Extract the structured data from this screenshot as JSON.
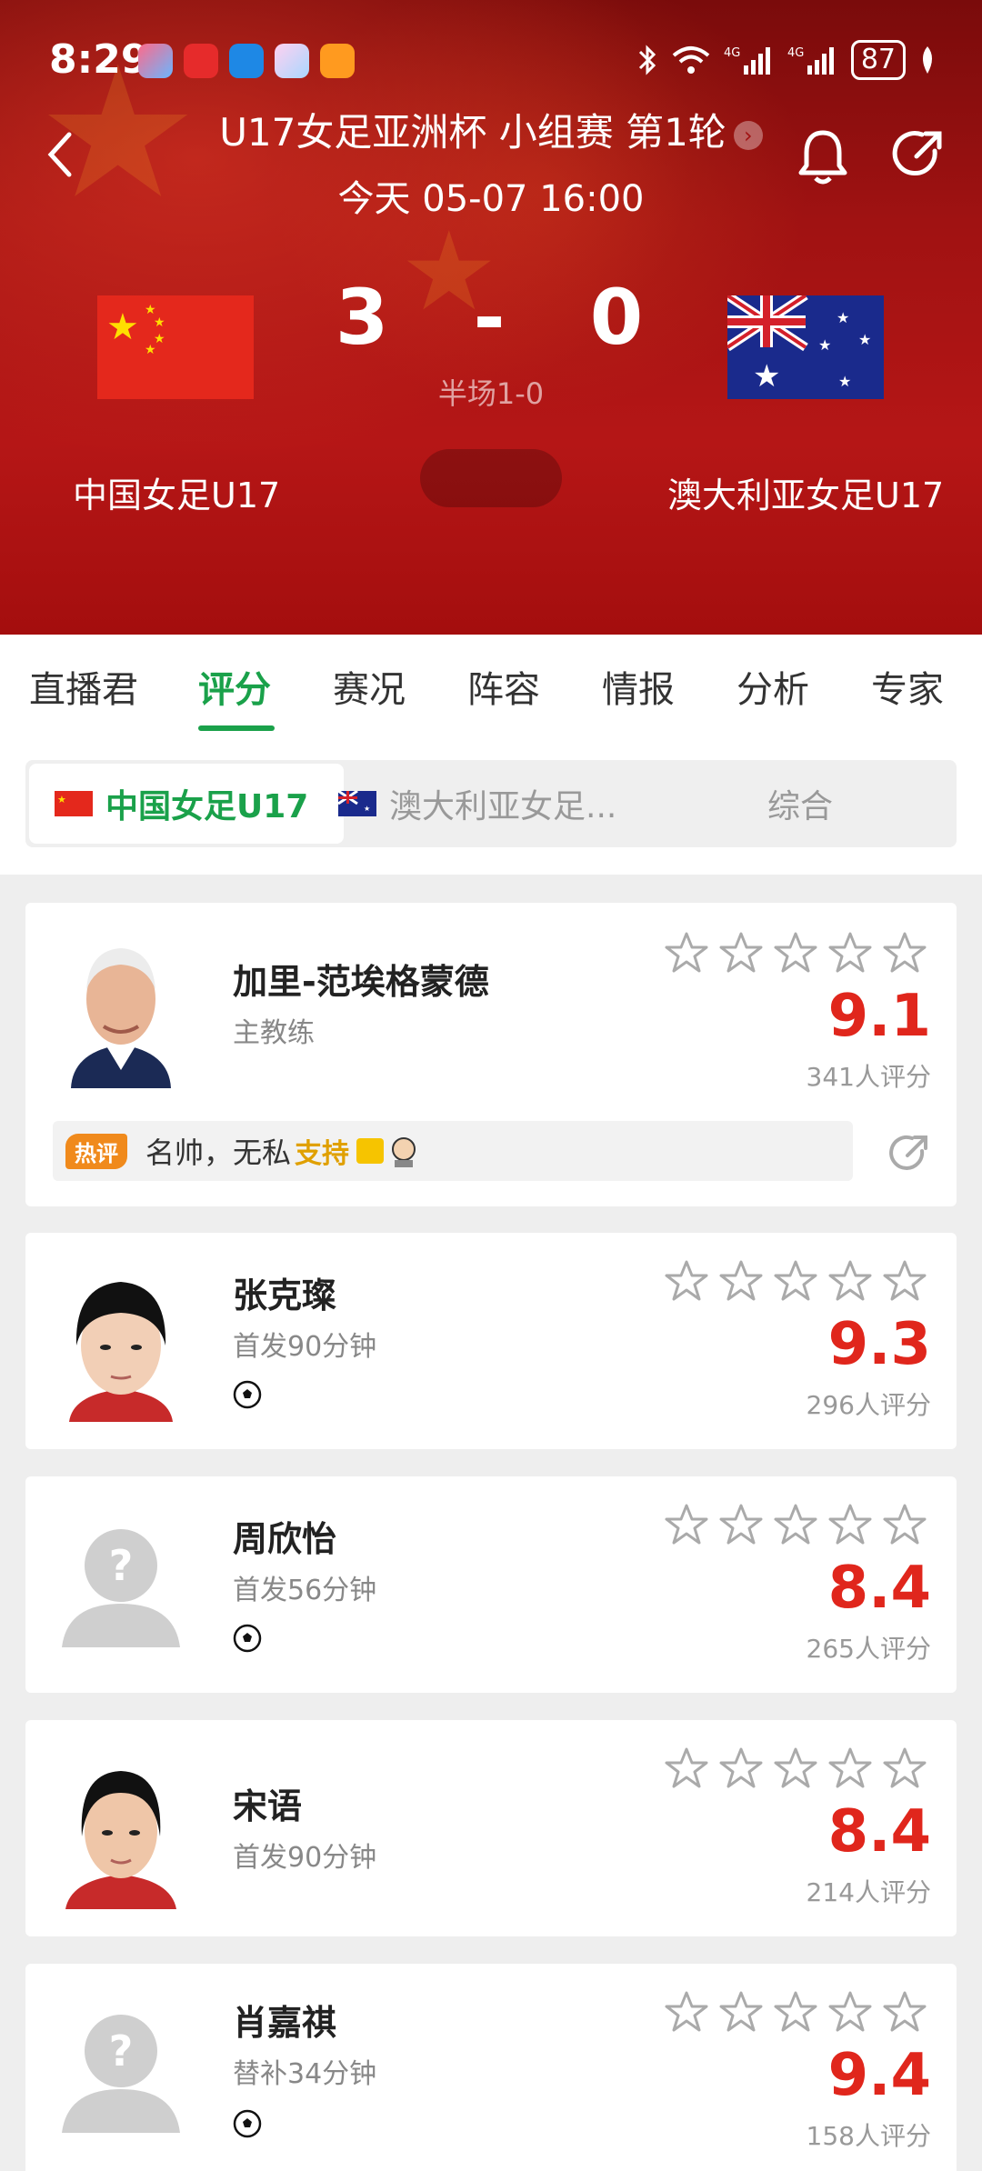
{
  "status_bar": {
    "time": "8:29",
    "battery": "87",
    "network": "4G"
  },
  "header": {
    "competition": "U17女足亚洲杯 小组赛 第1轮",
    "datetime": "今天 05-07 16:00",
    "home_team": "中国女足U17",
    "away_team": "澳大利亚女足U17",
    "home_score": "3",
    "away_score": "0",
    "score_separator": "-",
    "halftime": "半场1-0"
  },
  "tabs": [
    {
      "label": "直播君"
    },
    {
      "label": "评分"
    },
    {
      "label": "赛况"
    },
    {
      "label": "阵容"
    },
    {
      "label": "情报"
    },
    {
      "label": "分析"
    },
    {
      "label": "专家"
    }
  ],
  "team_switch": {
    "home": "中国女足U17",
    "away": "澳大利亚女足...",
    "overall": "综合"
  },
  "players": [
    {
      "name": "加里-范埃格蒙德",
      "info": "主教练",
      "rating": "9.1",
      "raters": "341人评分",
      "hot_label": "热评",
      "comment": "名帅，无私",
      "comment_emoji": "支持"
    },
    {
      "name": "张克璨",
      "info": "首发90分钟",
      "rating": "9.3",
      "raters": "296人评分"
    },
    {
      "name": "周欣怡",
      "info": "首发56分钟",
      "rating": "8.4",
      "raters": "265人评分"
    },
    {
      "name": "宋语",
      "info": "首发90分钟",
      "rating": "8.4",
      "raters": "214人评分"
    },
    {
      "name": "肖嘉祺",
      "info": "替补34分钟",
      "rating": "9.4",
      "raters": "158人评分"
    }
  ],
  "colors": {
    "accent_green": "#1aa14a",
    "rating_red": "#e0261c",
    "header_red": "#a01212"
  }
}
